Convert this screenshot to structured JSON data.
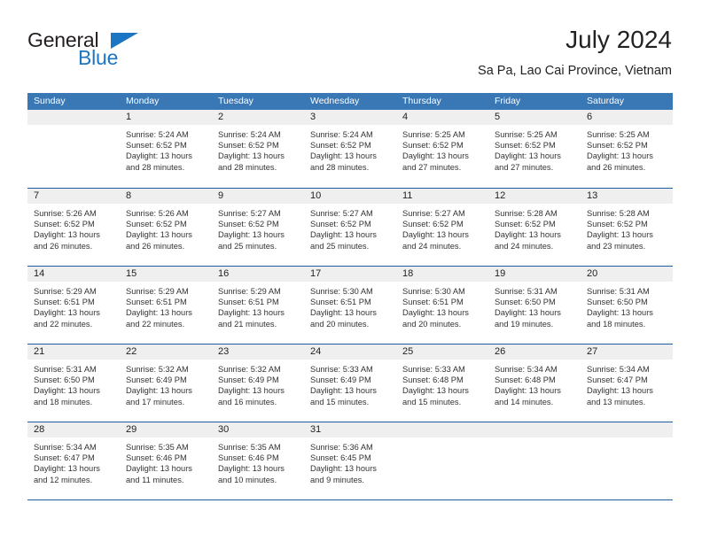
{
  "brand": {
    "name_top": "General",
    "name_bottom": "Blue",
    "triangle_icon": "triangle-icon",
    "accent_color": "#1c76c4"
  },
  "header": {
    "title": "July 2024",
    "subtitle": "Sa Pa, Lao Cai Province, Vietnam"
  },
  "calendar": {
    "header_bg": "#3a77b5",
    "rule_color": "#1b5fa0",
    "day_band_bg": "#efefef",
    "weekdays": [
      "Sunday",
      "Monday",
      "Tuesday",
      "Wednesday",
      "Thursday",
      "Friday",
      "Saturday"
    ],
    "weeks": [
      [
        {
          "day": "",
          "empty": true,
          "sunrise": "",
          "sunset": "",
          "daylight_line1": "",
          "daylight_line2": ""
        },
        {
          "day": "1",
          "sunrise": "Sunrise: 5:24 AM",
          "sunset": "Sunset: 6:52 PM",
          "daylight_line1": "Daylight: 13 hours",
          "daylight_line2": "and 28 minutes."
        },
        {
          "day": "2",
          "sunrise": "Sunrise: 5:24 AM",
          "sunset": "Sunset: 6:52 PM",
          "daylight_line1": "Daylight: 13 hours",
          "daylight_line2": "and 28 minutes."
        },
        {
          "day": "3",
          "sunrise": "Sunrise: 5:24 AM",
          "sunset": "Sunset: 6:52 PM",
          "daylight_line1": "Daylight: 13 hours",
          "daylight_line2": "and 28 minutes."
        },
        {
          "day": "4",
          "sunrise": "Sunrise: 5:25 AM",
          "sunset": "Sunset: 6:52 PM",
          "daylight_line1": "Daylight: 13 hours",
          "daylight_line2": "and 27 minutes."
        },
        {
          "day": "5",
          "sunrise": "Sunrise: 5:25 AM",
          "sunset": "Sunset: 6:52 PM",
          "daylight_line1": "Daylight: 13 hours",
          "daylight_line2": "and 27 minutes."
        },
        {
          "day": "6",
          "sunrise": "Sunrise: 5:25 AM",
          "sunset": "Sunset: 6:52 PM",
          "daylight_line1": "Daylight: 13 hours",
          "daylight_line2": "and 26 minutes."
        }
      ],
      [
        {
          "day": "7",
          "sunrise": "Sunrise: 5:26 AM",
          "sunset": "Sunset: 6:52 PM",
          "daylight_line1": "Daylight: 13 hours",
          "daylight_line2": "and 26 minutes."
        },
        {
          "day": "8",
          "sunrise": "Sunrise: 5:26 AM",
          "sunset": "Sunset: 6:52 PM",
          "daylight_line1": "Daylight: 13 hours",
          "daylight_line2": "and 26 minutes."
        },
        {
          "day": "9",
          "sunrise": "Sunrise: 5:27 AM",
          "sunset": "Sunset: 6:52 PM",
          "daylight_line1": "Daylight: 13 hours",
          "daylight_line2": "and 25 minutes."
        },
        {
          "day": "10",
          "sunrise": "Sunrise: 5:27 AM",
          "sunset": "Sunset: 6:52 PM",
          "daylight_line1": "Daylight: 13 hours",
          "daylight_line2": "and 25 minutes."
        },
        {
          "day": "11",
          "sunrise": "Sunrise: 5:27 AM",
          "sunset": "Sunset: 6:52 PM",
          "daylight_line1": "Daylight: 13 hours",
          "daylight_line2": "and 24 minutes."
        },
        {
          "day": "12",
          "sunrise": "Sunrise: 5:28 AM",
          "sunset": "Sunset: 6:52 PM",
          "daylight_line1": "Daylight: 13 hours",
          "daylight_line2": "and 24 minutes."
        },
        {
          "day": "13",
          "sunrise": "Sunrise: 5:28 AM",
          "sunset": "Sunset: 6:52 PM",
          "daylight_line1": "Daylight: 13 hours",
          "daylight_line2": "and 23 minutes."
        }
      ],
      [
        {
          "day": "14",
          "sunrise": "Sunrise: 5:29 AM",
          "sunset": "Sunset: 6:51 PM",
          "daylight_line1": "Daylight: 13 hours",
          "daylight_line2": "and 22 minutes."
        },
        {
          "day": "15",
          "sunrise": "Sunrise: 5:29 AM",
          "sunset": "Sunset: 6:51 PM",
          "daylight_line1": "Daylight: 13 hours",
          "daylight_line2": "and 22 minutes."
        },
        {
          "day": "16",
          "sunrise": "Sunrise: 5:29 AM",
          "sunset": "Sunset: 6:51 PM",
          "daylight_line1": "Daylight: 13 hours",
          "daylight_line2": "and 21 minutes."
        },
        {
          "day": "17",
          "sunrise": "Sunrise: 5:30 AM",
          "sunset": "Sunset: 6:51 PM",
          "daylight_line1": "Daylight: 13 hours",
          "daylight_line2": "and 20 minutes."
        },
        {
          "day": "18",
          "sunrise": "Sunrise: 5:30 AM",
          "sunset": "Sunset: 6:51 PM",
          "daylight_line1": "Daylight: 13 hours",
          "daylight_line2": "and 20 minutes."
        },
        {
          "day": "19",
          "sunrise": "Sunrise: 5:31 AM",
          "sunset": "Sunset: 6:50 PM",
          "daylight_line1": "Daylight: 13 hours",
          "daylight_line2": "and 19 minutes."
        },
        {
          "day": "20",
          "sunrise": "Sunrise: 5:31 AM",
          "sunset": "Sunset: 6:50 PM",
          "daylight_line1": "Daylight: 13 hours",
          "daylight_line2": "and 18 minutes."
        }
      ],
      [
        {
          "day": "21",
          "sunrise": "Sunrise: 5:31 AM",
          "sunset": "Sunset: 6:50 PM",
          "daylight_line1": "Daylight: 13 hours",
          "daylight_line2": "and 18 minutes."
        },
        {
          "day": "22",
          "sunrise": "Sunrise: 5:32 AM",
          "sunset": "Sunset: 6:49 PM",
          "daylight_line1": "Daylight: 13 hours",
          "daylight_line2": "and 17 minutes."
        },
        {
          "day": "23",
          "sunrise": "Sunrise: 5:32 AM",
          "sunset": "Sunset: 6:49 PM",
          "daylight_line1": "Daylight: 13 hours",
          "daylight_line2": "and 16 minutes."
        },
        {
          "day": "24",
          "sunrise": "Sunrise: 5:33 AM",
          "sunset": "Sunset: 6:49 PM",
          "daylight_line1": "Daylight: 13 hours",
          "daylight_line2": "and 15 minutes."
        },
        {
          "day": "25",
          "sunrise": "Sunrise: 5:33 AM",
          "sunset": "Sunset: 6:48 PM",
          "daylight_line1": "Daylight: 13 hours",
          "daylight_line2": "and 15 minutes."
        },
        {
          "day": "26",
          "sunrise": "Sunrise: 5:34 AM",
          "sunset": "Sunset: 6:48 PM",
          "daylight_line1": "Daylight: 13 hours",
          "daylight_line2": "and 14 minutes."
        },
        {
          "day": "27",
          "sunrise": "Sunrise: 5:34 AM",
          "sunset": "Sunset: 6:47 PM",
          "daylight_line1": "Daylight: 13 hours",
          "daylight_line2": "and 13 minutes."
        }
      ],
      [
        {
          "day": "28",
          "sunrise": "Sunrise: 5:34 AM",
          "sunset": "Sunset: 6:47 PM",
          "daylight_line1": "Daylight: 13 hours",
          "daylight_line2": "and 12 minutes."
        },
        {
          "day": "29",
          "sunrise": "Sunrise: 5:35 AM",
          "sunset": "Sunset: 6:46 PM",
          "daylight_line1": "Daylight: 13 hours",
          "daylight_line2": "and 11 minutes."
        },
        {
          "day": "30",
          "sunrise": "Sunrise: 5:35 AM",
          "sunset": "Sunset: 6:46 PM",
          "daylight_line1": "Daylight: 13 hours",
          "daylight_line2": "and 10 minutes."
        },
        {
          "day": "31",
          "sunrise": "Sunrise: 5:36 AM",
          "sunset": "Sunset: 6:45 PM",
          "daylight_line1": "Daylight: 13 hours",
          "daylight_line2": "and 9 minutes."
        },
        {
          "day": "",
          "empty": true,
          "sunrise": "",
          "sunset": "",
          "daylight_line1": "",
          "daylight_line2": ""
        },
        {
          "day": "",
          "empty": true,
          "sunrise": "",
          "sunset": "",
          "daylight_line1": "",
          "daylight_line2": ""
        },
        {
          "day": "",
          "empty": true,
          "sunrise": "",
          "sunset": "",
          "daylight_line1": "",
          "daylight_line2": ""
        }
      ]
    ]
  }
}
